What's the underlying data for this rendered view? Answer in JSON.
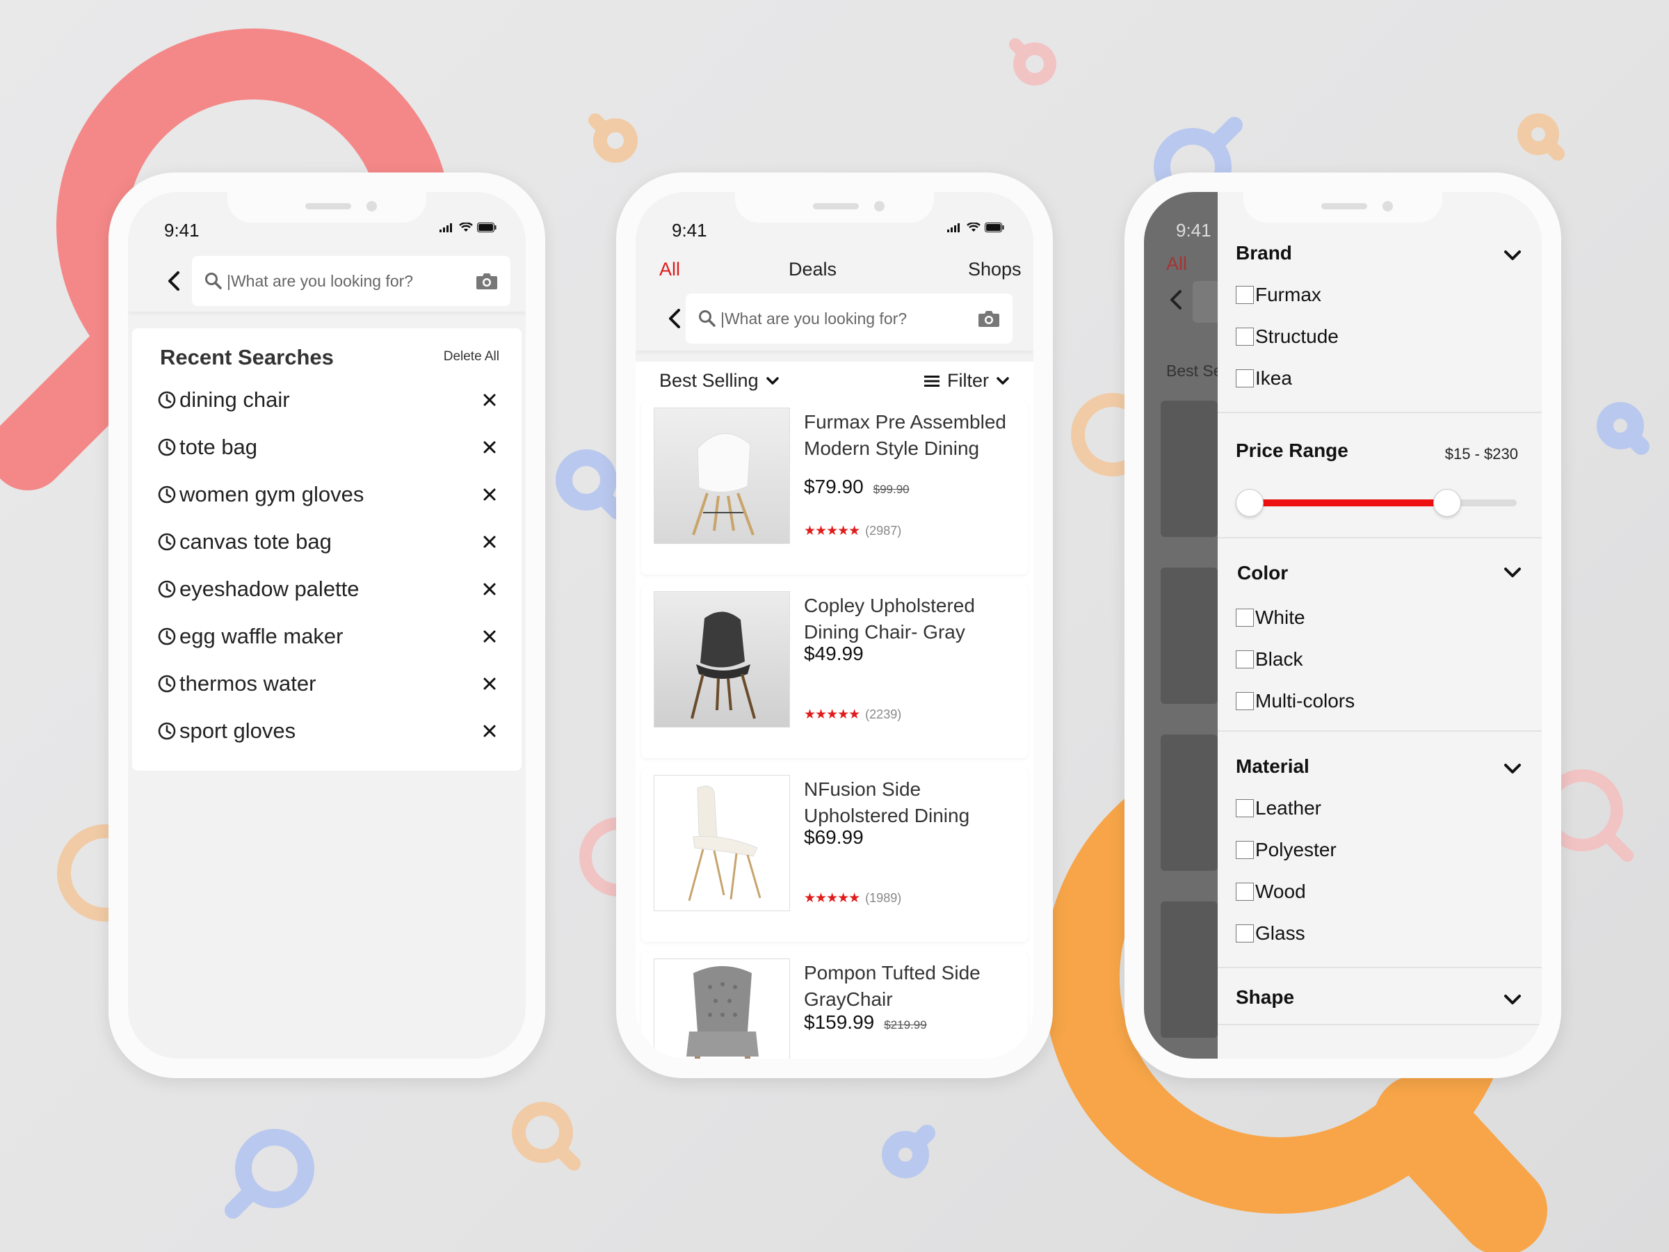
{
  "colors": {
    "accent": "#e01b1b",
    "slider_fill": "#ee1111",
    "deco_red": "#f48888",
    "deco_orange": "#f7a548",
    "deco_blue": "#b9c8ee",
    "deco_peach": "#f1cba5",
    "deco_pink": "#f1c3c3"
  },
  "status": {
    "time": "9:41"
  },
  "search": {
    "placeholder": "|What are you looking for?"
  },
  "recent": {
    "title": "Recent Searches",
    "delete_all": "Delete All",
    "items": [
      "dining chair",
      "tote bag",
      "women gym gloves",
      "canvas tote bag",
      "eyeshadow palette",
      "egg waffle maker",
      "thermos water",
      "sport gloves"
    ]
  },
  "tabs": [
    {
      "label": "All",
      "active": true
    },
    {
      "label": "Deals",
      "active": false
    },
    {
      "label": "Shops",
      "active": false
    }
  ],
  "listing": {
    "sort_label": "Best Selling",
    "filter_label": "Filter",
    "products": [
      {
        "name": "Furmax Pre Assembled Modern Style Dining",
        "price": "$79.90",
        "old_price": "$99.90",
        "stars": "★★★★★",
        "rating": 4.5,
        "reviews": "(2987)"
      },
      {
        "name": "Copley Upholstered Dining Chair- Gray",
        "price": "$49.99",
        "old_price": "",
        "stars": "★★★★★",
        "rating": 4.5,
        "reviews": "(2239)"
      },
      {
        "name": "NFusion Side Upholstered Dining",
        "price": "$69.99",
        "old_price": "",
        "stars": "★★★★★",
        "rating": 4.5,
        "reviews": "(1989)"
      },
      {
        "name": "Pompon Tufted Side GrayChair",
        "price": "$159.99",
        "old_price": "$219.99",
        "stars": "",
        "rating": null,
        "reviews": ""
      }
    ]
  },
  "filters": {
    "brand": {
      "title": "Brand",
      "options": [
        "Furmax",
        "Structude",
        "Ikea"
      ]
    },
    "price_range": {
      "title": "Price Range",
      "value_text": "$15 - $230",
      "min_fraction": 0.0,
      "max_fraction": 0.74
    },
    "color": {
      "title": "Color",
      "options": [
        "White",
        "Black",
        "Multi-colors"
      ]
    },
    "material": {
      "title": "Material",
      "options": [
        "Leather",
        "Polyester",
        "Wood",
        "Glass"
      ]
    },
    "shape": {
      "title": "Shape"
    }
  },
  "dimmed_background": {
    "time": "9:41",
    "tab": "All",
    "sort_partial": "Best Se"
  },
  "icons": {
    "back": "chevron-left-icon",
    "search": "search-icon",
    "camera": "camera-icon",
    "clock": "clock-icon",
    "close": "close-icon",
    "chevron_down": "chevron-down-icon",
    "menu": "menu-lines-icon"
  }
}
